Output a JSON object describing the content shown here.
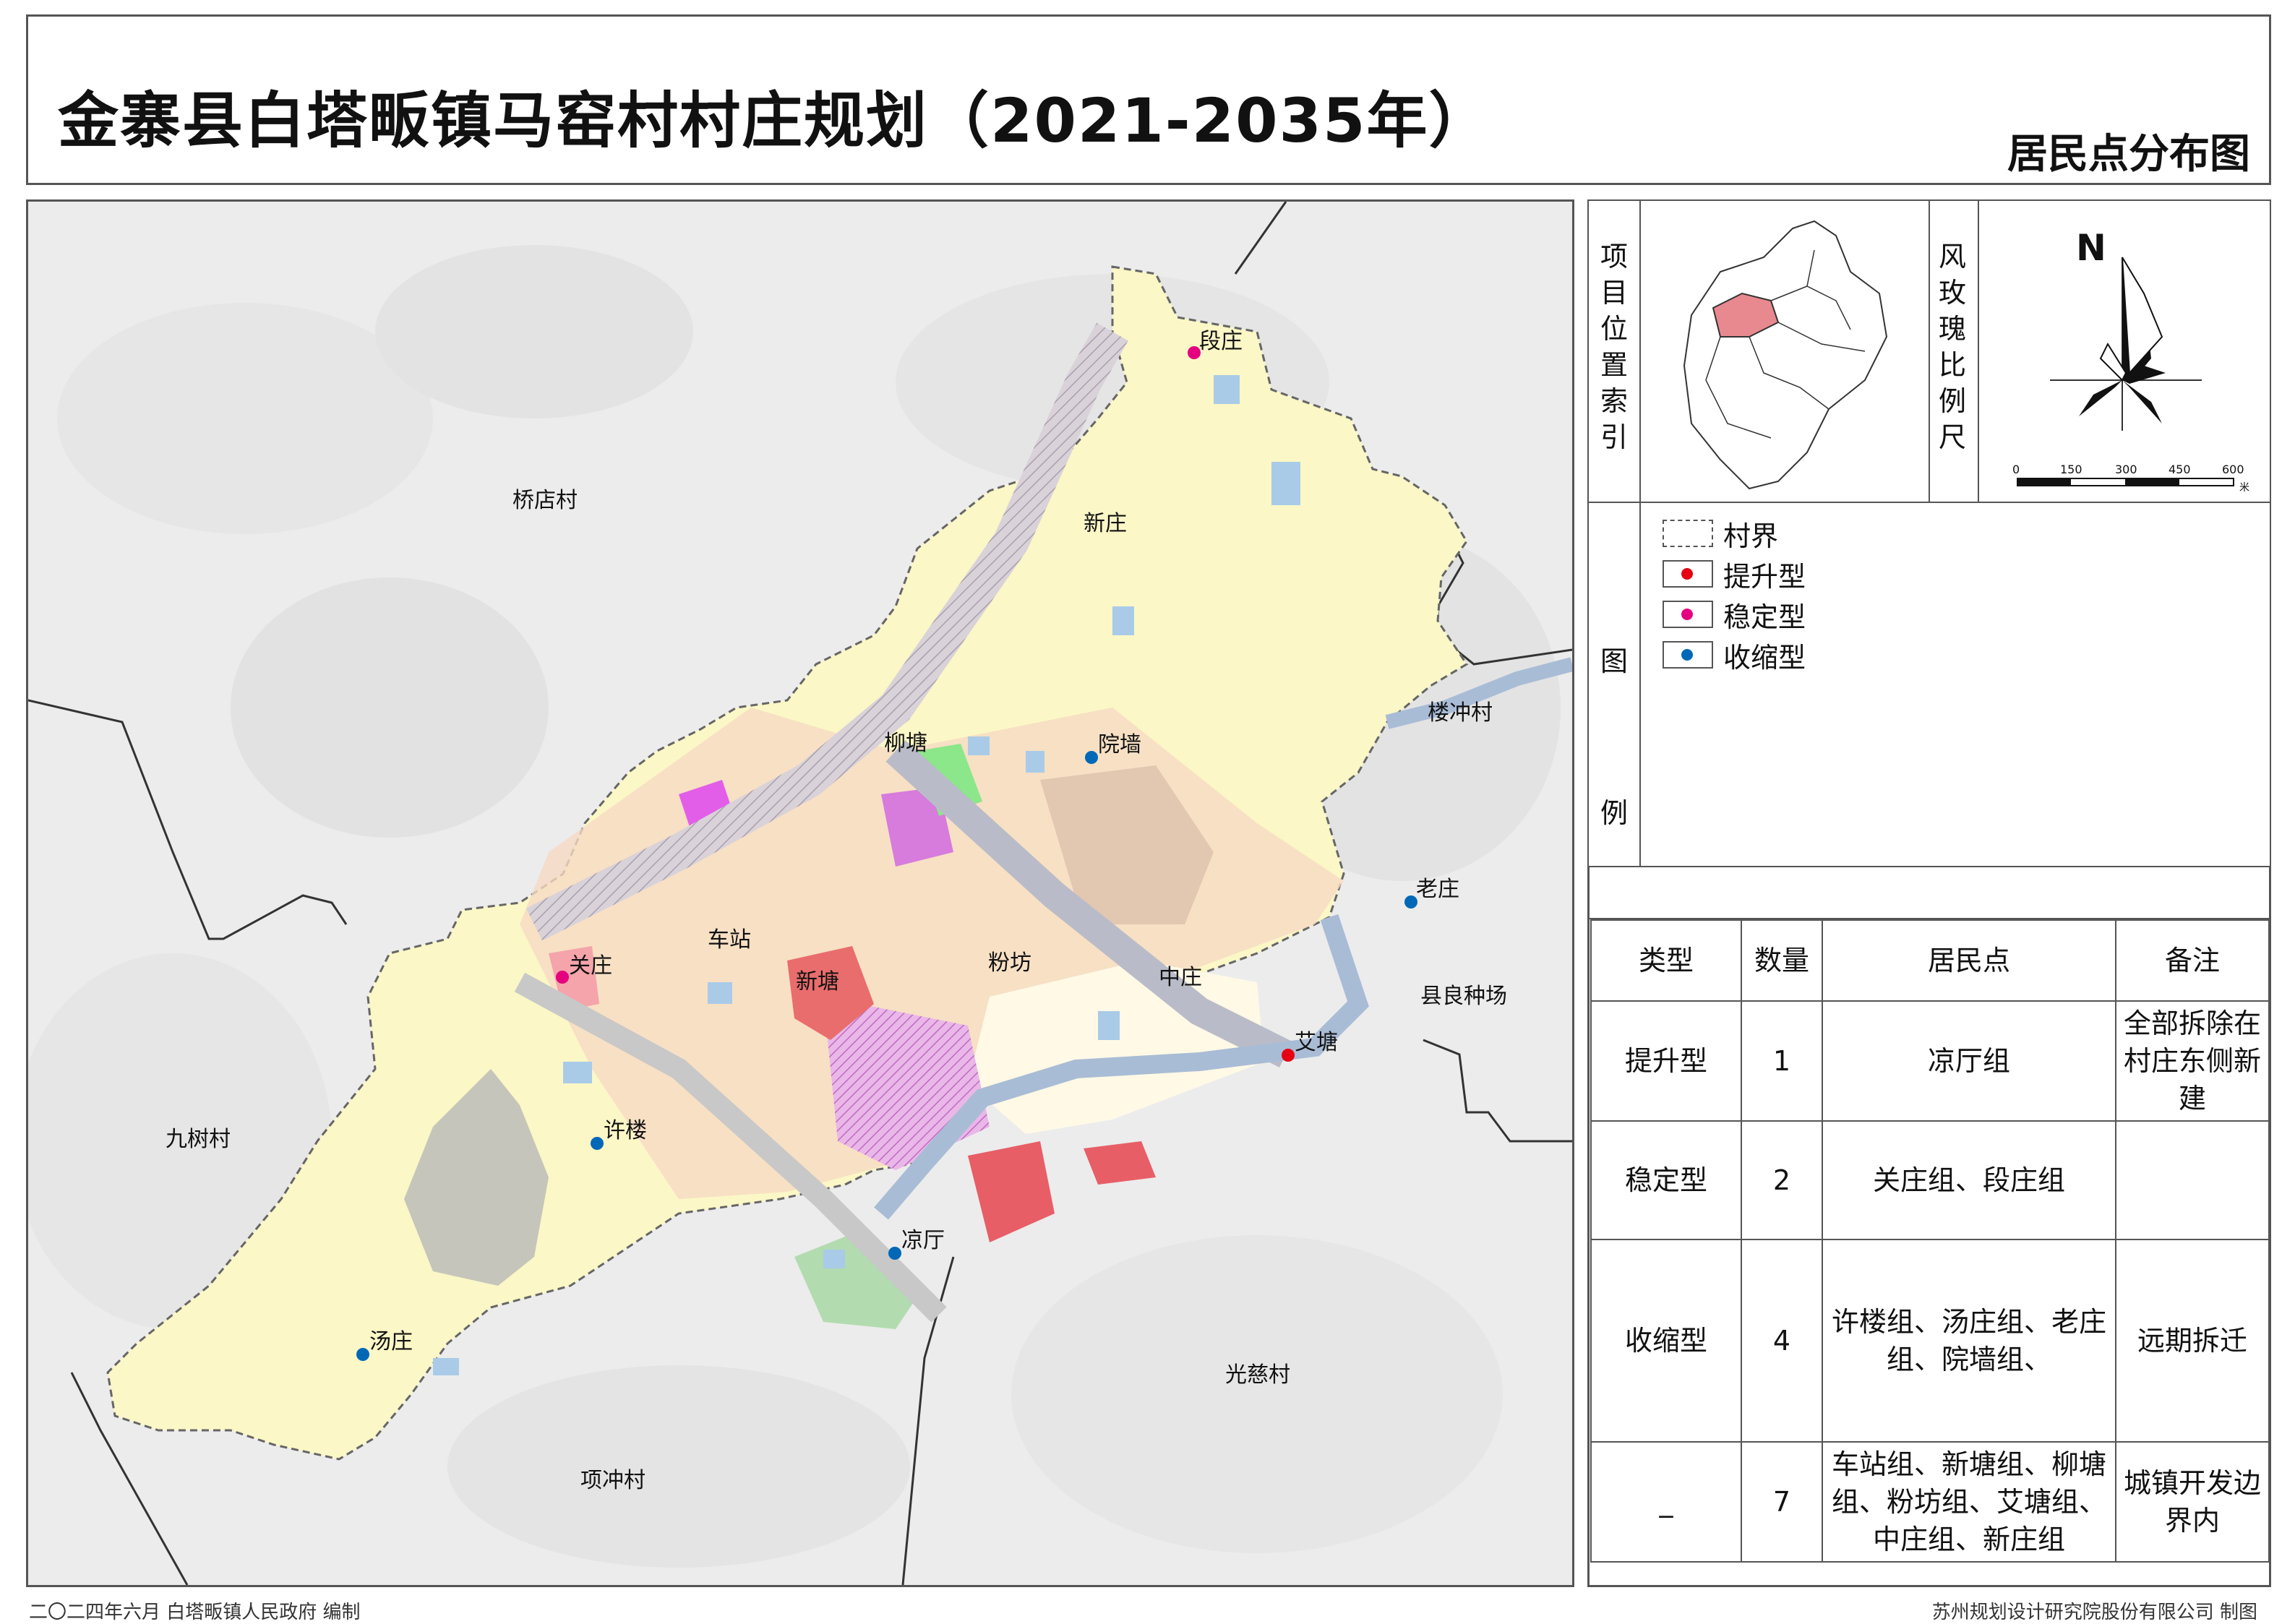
{
  "title": "金寨县白塔畈镇马窑村村庄规划（2021-2035年）",
  "sheet_name": "居民点分布图",
  "index_label": "项目位置索引",
  "rose_label": "风玫瑰比例尺",
  "north": "N",
  "scale": {
    "ticks": [
      "0",
      "150",
      "300",
      "450",
      "600"
    ],
    "unit": "米"
  },
  "legend": {
    "heading": "图例",
    "items": [
      {
        "label": "村界",
        "color": ""
      },
      {
        "label": "提升型",
        "color": "#e60012"
      },
      {
        "label": "稳定型",
        "color": "#e4007f"
      },
      {
        "label": "收缩型",
        "color": "#0068b7"
      }
    ]
  },
  "table": {
    "headers": [
      "类型",
      "数量",
      "居民点",
      "备注"
    ],
    "rows": [
      {
        "type": "提升型",
        "count": "1",
        "sites": "凉厅组",
        "note": "全部拆除在村庄东侧新建"
      },
      {
        "type": "稳定型",
        "count": "2",
        "sites": "关庄组、段庄组",
        "note": ""
      },
      {
        "type": "收缩型",
        "count": "4",
        "sites": "许楼组、汤庄组、老庄组、院墙组、",
        "note": "远期拆迁"
      },
      {
        "type": "_",
        "count": "7",
        "sites": "车站组、新塘组、柳塘组、粉坊组、艾塘组、中庄组、新庄组",
        "note": "城镇开发边界内"
      }
    ]
  },
  "map": {
    "villages": [
      "桥店村",
      "楼冲村",
      "县良种场",
      "九树村",
      "光慈村",
      "项冲村"
    ],
    "settlements": [
      {
        "name": "段庄",
        "type": "stable"
      },
      {
        "name": "新庄",
        "type": "none"
      },
      {
        "name": "柳塘",
        "type": "none"
      },
      {
        "name": "院墙",
        "type": "shrink"
      },
      {
        "name": "老庄",
        "type": "shrink"
      },
      {
        "name": "关庄",
        "type": "stable"
      },
      {
        "name": "车站",
        "type": "none"
      },
      {
        "name": "新塘",
        "type": "none"
      },
      {
        "name": "粉坊",
        "type": "none"
      },
      {
        "name": "中庄",
        "type": "none"
      },
      {
        "name": "艾塘",
        "type": "upgrade"
      },
      {
        "name": "许楼",
        "type": "shrink"
      },
      {
        "name": "凉厅",
        "type": "shrink"
      },
      {
        "name": "汤庄",
        "type": "shrink"
      }
    ]
  },
  "footer_left": "二〇二四年六月  白塔畈镇人民政府  编制",
  "footer_right": "苏州规划设计研究院股份有限公司  制图"
}
